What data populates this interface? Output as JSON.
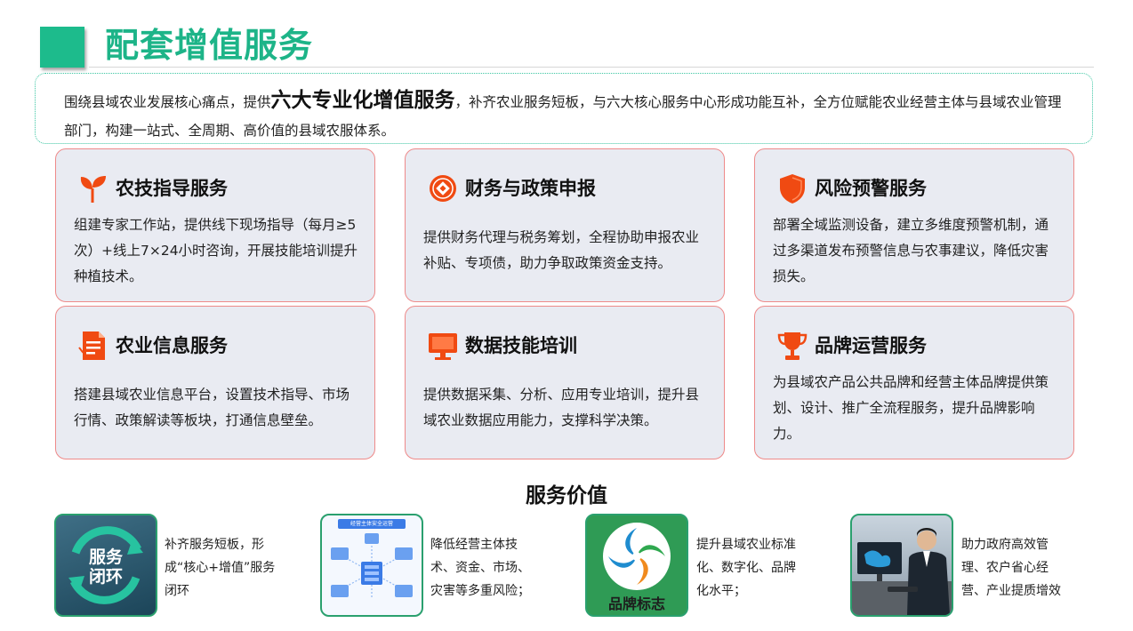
{
  "header": {
    "title": "配套增值服务"
  },
  "intro": {
    "before": "围绕县域农业发展核心痛点，提供",
    "emphasis": "六大专业化增值服务",
    "after": "，补齐农业服务短板，与六大核心服务中心形成功能互补，全方位赋能农业经营主体与县域农业管理部门，构建一站式、全周期、高价值的县域农服体系。"
  },
  "cards": [
    {
      "title": "农技指导服务",
      "icon": "sprout-icon",
      "desc": "组建专家工作站，提供线下现场指导（每月≥5次）+线上7×24小时咨询，开展技能培训提升种植技术。"
    },
    {
      "title": "财务与政策申报",
      "icon": "coin-icon",
      "desc": "提供财务代理与税务筹划，全程协助申报农业补贴、专项债，助力争取政策资金支持。"
    },
    {
      "title": "风险预警服务",
      "icon": "shield-icon",
      "desc": "部署全域监测设备，建立多维度预警机制，通过多渠道发布预警信息与农事建议，降低灾害损失。"
    },
    {
      "title": "农业信息服务",
      "icon": "document-icon",
      "desc": "搭建县域农业信息平台，设置技术指导、市场行情、政策解读等板块，打通信息壁垒。"
    },
    {
      "title": "数据技能培训",
      "icon": "monitor-icon",
      "desc": "提供数据采集、分析、应用专业培训，提升县域农业数据应用能力，支撑科学决策。"
    },
    {
      "title": "品牌运营服务",
      "icon": "trophy-icon",
      "desc": "为县域农产品公共品牌和经营主体品牌提供策划、设计、推广全流程服务，提升品牌影响力。"
    }
  ],
  "value_section": {
    "title": "服务价值",
    "items": [
      {
        "image_label": "服务闭环",
        "text": "补齐服务短板，形成“核心+增值”服务闭环"
      },
      {
        "image_label": "经营主体安全运营",
        "text": "降低经营主体技术、资金、市场、灾害等多重风险；"
      },
      {
        "image_label": "品牌标志",
        "text": "提升县域农业标准化、数字化、品牌化水平；"
      },
      {
        "image_label": "",
        "text": "助力政府高效管理、农户省心经营、产业提质增效"
      }
    ]
  },
  "colors": {
    "accent": "#1db488",
    "icon": "#f04a12",
    "card_bg": "#e9ebf2",
    "card_border": "#ee8a8a"
  }
}
